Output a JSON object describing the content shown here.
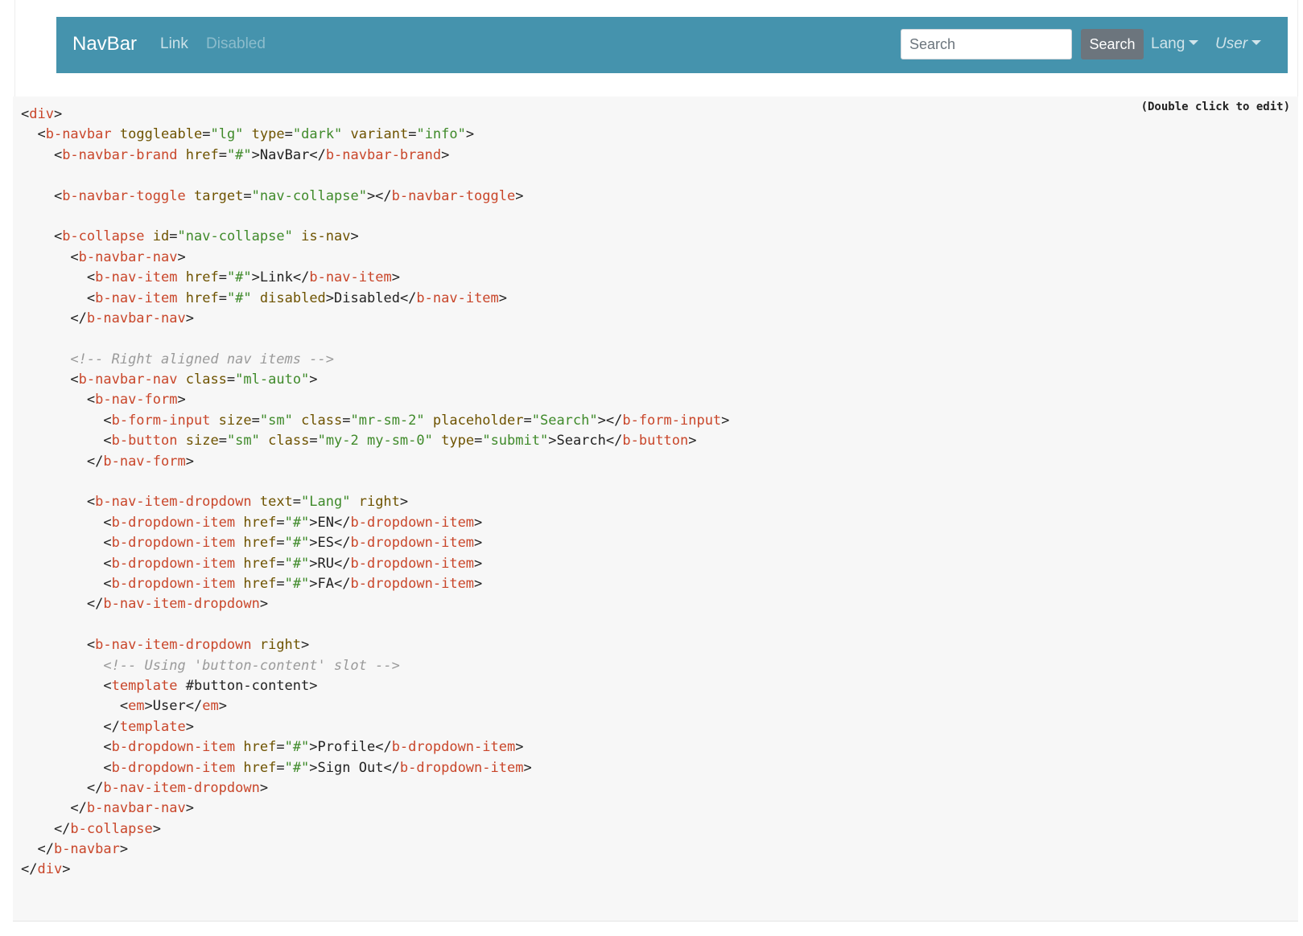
{
  "navbar": {
    "brand": "NavBar",
    "links": [
      "Link",
      "Disabled"
    ],
    "search": {
      "placeholder": "Search",
      "button_label": "Search"
    },
    "lang_dropdown": "Lang",
    "user_dropdown": "User",
    "colors": {
      "background": "#4593ad",
      "search_button": "#6c757d"
    },
    "icons": [
      "caret-down-icon"
    ]
  },
  "code_panel": {
    "hint": "(Double click to edit)",
    "colors": {
      "background": "#f7f7f7",
      "tag": "#c9462a",
      "attribute": "#6e5300",
      "string": "#3f8a2a",
      "comment": "#9a9a9a"
    },
    "lines": [
      [
        [
          "p",
          "<"
        ],
        [
          "tag",
          "div"
        ],
        [
          "p",
          ">"
        ]
      ],
      [
        [
          "p",
          "  <"
        ],
        [
          "tag",
          "b-navbar"
        ],
        [
          "p",
          " "
        ],
        [
          "attr",
          "toggleable"
        ],
        [
          "p",
          "="
        ],
        [
          "str",
          "\"lg\""
        ],
        [
          "p",
          " "
        ],
        [
          "attr",
          "type"
        ],
        [
          "p",
          "="
        ],
        [
          "str",
          "\"dark\""
        ],
        [
          "p",
          " "
        ],
        [
          "attr",
          "variant"
        ],
        [
          "p",
          "="
        ],
        [
          "str",
          "\"info\""
        ],
        [
          "p",
          ">"
        ]
      ],
      [
        [
          "p",
          "    <"
        ],
        [
          "tag",
          "b-navbar-brand"
        ],
        [
          "p",
          " "
        ],
        [
          "attr",
          "href"
        ],
        [
          "p",
          "="
        ],
        [
          "str",
          "\"#\""
        ],
        [
          "p",
          ">"
        ],
        [
          "txt",
          "NavBar"
        ],
        [
          "p",
          "</"
        ],
        [
          "tag",
          "b-navbar-brand"
        ],
        [
          "p",
          ">"
        ]
      ],
      [],
      [
        [
          "p",
          "    <"
        ],
        [
          "tag",
          "b-navbar-toggle"
        ],
        [
          "p",
          " "
        ],
        [
          "attr",
          "target"
        ],
        [
          "p",
          "="
        ],
        [
          "str",
          "\"nav-collapse\""
        ],
        [
          "p",
          "></"
        ],
        [
          "tag",
          "b-navbar-toggle"
        ],
        [
          "p",
          ">"
        ]
      ],
      [],
      [
        [
          "p",
          "    <"
        ],
        [
          "tag",
          "b-collapse"
        ],
        [
          "p",
          " "
        ],
        [
          "attr",
          "id"
        ],
        [
          "p",
          "="
        ],
        [
          "str",
          "\"nav-collapse\""
        ],
        [
          "p",
          " "
        ],
        [
          "attr",
          "is-nav"
        ],
        [
          "p",
          ">"
        ]
      ],
      [
        [
          "p",
          "      <"
        ],
        [
          "tag",
          "b-navbar-nav"
        ],
        [
          "p",
          ">"
        ]
      ],
      [
        [
          "p",
          "        <"
        ],
        [
          "tag",
          "b-nav-item"
        ],
        [
          "p",
          " "
        ],
        [
          "attr",
          "href"
        ],
        [
          "p",
          "="
        ],
        [
          "str",
          "\"#\""
        ],
        [
          "p",
          ">"
        ],
        [
          "txt",
          "Link"
        ],
        [
          "p",
          "</"
        ],
        [
          "tag",
          "b-nav-item"
        ],
        [
          "p",
          ">"
        ]
      ],
      [
        [
          "p",
          "        <"
        ],
        [
          "tag",
          "b-nav-item"
        ],
        [
          "p",
          " "
        ],
        [
          "attr",
          "href"
        ],
        [
          "p",
          "="
        ],
        [
          "str",
          "\"#\""
        ],
        [
          "p",
          " "
        ],
        [
          "attr",
          "disabled"
        ],
        [
          "p",
          ">"
        ],
        [
          "txt",
          "Disabled"
        ],
        [
          "p",
          "</"
        ],
        [
          "tag",
          "b-nav-item"
        ],
        [
          "p",
          ">"
        ]
      ],
      [
        [
          "p",
          "      </"
        ],
        [
          "tag",
          "b-navbar-nav"
        ],
        [
          "p",
          ">"
        ]
      ],
      [],
      [
        [
          "p",
          "      "
        ],
        [
          "com",
          "<!-- Right aligned nav items -->"
        ]
      ],
      [
        [
          "p",
          "      <"
        ],
        [
          "tag",
          "b-navbar-nav"
        ],
        [
          "p",
          " "
        ],
        [
          "attr",
          "class"
        ],
        [
          "p",
          "="
        ],
        [
          "str",
          "\"ml-auto\""
        ],
        [
          "p",
          ">"
        ]
      ],
      [
        [
          "p",
          "        <"
        ],
        [
          "tag",
          "b-nav-form"
        ],
        [
          "p",
          ">"
        ]
      ],
      [
        [
          "p",
          "          <"
        ],
        [
          "tag",
          "b-form-input"
        ],
        [
          "p",
          " "
        ],
        [
          "attr",
          "size"
        ],
        [
          "p",
          "="
        ],
        [
          "str",
          "\"sm\""
        ],
        [
          "p",
          " "
        ],
        [
          "attr",
          "class"
        ],
        [
          "p",
          "="
        ],
        [
          "str",
          "\"mr-sm-2\""
        ],
        [
          "p",
          " "
        ],
        [
          "attr",
          "placeholder"
        ],
        [
          "p",
          "="
        ],
        [
          "str",
          "\"Search\""
        ],
        [
          "p",
          "></"
        ],
        [
          "tag",
          "b-form-input"
        ],
        [
          "p",
          ">"
        ]
      ],
      [
        [
          "p",
          "          <"
        ],
        [
          "tag",
          "b-button"
        ],
        [
          "p",
          " "
        ],
        [
          "attr",
          "size"
        ],
        [
          "p",
          "="
        ],
        [
          "str",
          "\"sm\""
        ],
        [
          "p",
          " "
        ],
        [
          "attr",
          "class"
        ],
        [
          "p",
          "="
        ],
        [
          "str",
          "\"my-2 my-sm-0\""
        ],
        [
          "p",
          " "
        ],
        [
          "attr",
          "type"
        ],
        [
          "p",
          "="
        ],
        [
          "str",
          "\"submit\""
        ],
        [
          "p",
          ">"
        ],
        [
          "txt",
          "Search"
        ],
        [
          "p",
          "</"
        ],
        [
          "tag",
          "b-button"
        ],
        [
          "p",
          ">"
        ]
      ],
      [
        [
          "p",
          "        </"
        ],
        [
          "tag",
          "b-nav-form"
        ],
        [
          "p",
          ">"
        ]
      ],
      [],
      [
        [
          "p",
          "        <"
        ],
        [
          "tag",
          "b-nav-item-dropdown"
        ],
        [
          "p",
          " "
        ],
        [
          "attr",
          "text"
        ],
        [
          "p",
          "="
        ],
        [
          "str",
          "\"Lang\""
        ],
        [
          "p",
          " "
        ],
        [
          "attr",
          "right"
        ],
        [
          "p",
          ">"
        ]
      ],
      [
        [
          "p",
          "          <"
        ],
        [
          "tag",
          "b-dropdown-item"
        ],
        [
          "p",
          " "
        ],
        [
          "attr",
          "href"
        ],
        [
          "p",
          "="
        ],
        [
          "str",
          "\"#\""
        ],
        [
          "p",
          ">"
        ],
        [
          "txt",
          "EN"
        ],
        [
          "p",
          "</"
        ],
        [
          "tag",
          "b-dropdown-item"
        ],
        [
          "p",
          ">"
        ]
      ],
      [
        [
          "p",
          "          <"
        ],
        [
          "tag",
          "b-dropdown-item"
        ],
        [
          "p",
          " "
        ],
        [
          "attr",
          "href"
        ],
        [
          "p",
          "="
        ],
        [
          "str",
          "\"#\""
        ],
        [
          "p",
          ">"
        ],
        [
          "txt",
          "ES"
        ],
        [
          "p",
          "</"
        ],
        [
          "tag",
          "b-dropdown-item"
        ],
        [
          "p",
          ">"
        ]
      ],
      [
        [
          "p",
          "          <"
        ],
        [
          "tag",
          "b-dropdown-item"
        ],
        [
          "p",
          " "
        ],
        [
          "attr",
          "href"
        ],
        [
          "p",
          "="
        ],
        [
          "str",
          "\"#\""
        ],
        [
          "p",
          ">"
        ],
        [
          "txt",
          "RU"
        ],
        [
          "p",
          "</"
        ],
        [
          "tag",
          "b-dropdown-item"
        ],
        [
          "p",
          ">"
        ]
      ],
      [
        [
          "p",
          "          <"
        ],
        [
          "tag",
          "b-dropdown-item"
        ],
        [
          "p",
          " "
        ],
        [
          "attr",
          "href"
        ],
        [
          "p",
          "="
        ],
        [
          "str",
          "\"#\""
        ],
        [
          "p",
          ">"
        ],
        [
          "txt",
          "FA"
        ],
        [
          "p",
          "</"
        ],
        [
          "tag",
          "b-dropdown-item"
        ],
        [
          "p",
          ">"
        ]
      ],
      [
        [
          "p",
          "        </"
        ],
        [
          "tag",
          "b-nav-item-dropdown"
        ],
        [
          "p",
          ">"
        ]
      ],
      [],
      [
        [
          "p",
          "        <"
        ],
        [
          "tag",
          "b-nav-item-dropdown"
        ],
        [
          "p",
          " "
        ],
        [
          "attr",
          "right"
        ],
        [
          "p",
          ">"
        ]
      ],
      [
        [
          "p",
          "          "
        ],
        [
          "com",
          "<!-- Using 'button-content' slot -->"
        ]
      ],
      [
        [
          "p",
          "          <"
        ],
        [
          "tag",
          "template"
        ],
        [
          "p",
          " "
        ],
        [
          "txt",
          "#button-content"
        ],
        [
          "p",
          ">"
        ]
      ],
      [
        [
          "p",
          "            <"
        ],
        [
          "tag",
          "em"
        ],
        [
          "p",
          ">"
        ],
        [
          "txt",
          "User"
        ],
        [
          "p",
          "</"
        ],
        [
          "tag",
          "em"
        ],
        [
          "p",
          ">"
        ]
      ],
      [
        [
          "p",
          "          </"
        ],
        [
          "tag",
          "template"
        ],
        [
          "p",
          ">"
        ]
      ],
      [
        [
          "p",
          "          <"
        ],
        [
          "tag",
          "b-dropdown-item"
        ],
        [
          "p",
          " "
        ],
        [
          "attr",
          "href"
        ],
        [
          "p",
          "="
        ],
        [
          "str",
          "\"#\""
        ],
        [
          "p",
          ">"
        ],
        [
          "txt",
          "Profile"
        ],
        [
          "p",
          "</"
        ],
        [
          "tag",
          "b-dropdown-item"
        ],
        [
          "p",
          ">"
        ]
      ],
      [
        [
          "p",
          "          <"
        ],
        [
          "tag",
          "b-dropdown-item"
        ],
        [
          "p",
          " "
        ],
        [
          "attr",
          "href"
        ],
        [
          "p",
          "="
        ],
        [
          "str",
          "\"#\""
        ],
        [
          "p",
          ">"
        ],
        [
          "txt",
          "Sign Out"
        ],
        [
          "p",
          "</"
        ],
        [
          "tag",
          "b-dropdown-item"
        ],
        [
          "p",
          ">"
        ]
      ],
      [
        [
          "p",
          "        </"
        ],
        [
          "tag",
          "b-nav-item-dropdown"
        ],
        [
          "p",
          ">"
        ]
      ],
      [
        [
          "p",
          "      </"
        ],
        [
          "tag",
          "b-navbar-nav"
        ],
        [
          "p",
          ">"
        ]
      ],
      [
        [
          "p",
          "    </"
        ],
        [
          "tag",
          "b-collapse"
        ],
        [
          "p",
          ">"
        ]
      ],
      [
        [
          "p",
          "  </"
        ],
        [
          "tag",
          "b-navbar"
        ],
        [
          "p",
          ">"
        ]
      ],
      [
        [
          "p",
          "</"
        ],
        [
          "tag",
          "div"
        ],
        [
          "p",
          ">"
        ]
      ]
    ]
  }
}
